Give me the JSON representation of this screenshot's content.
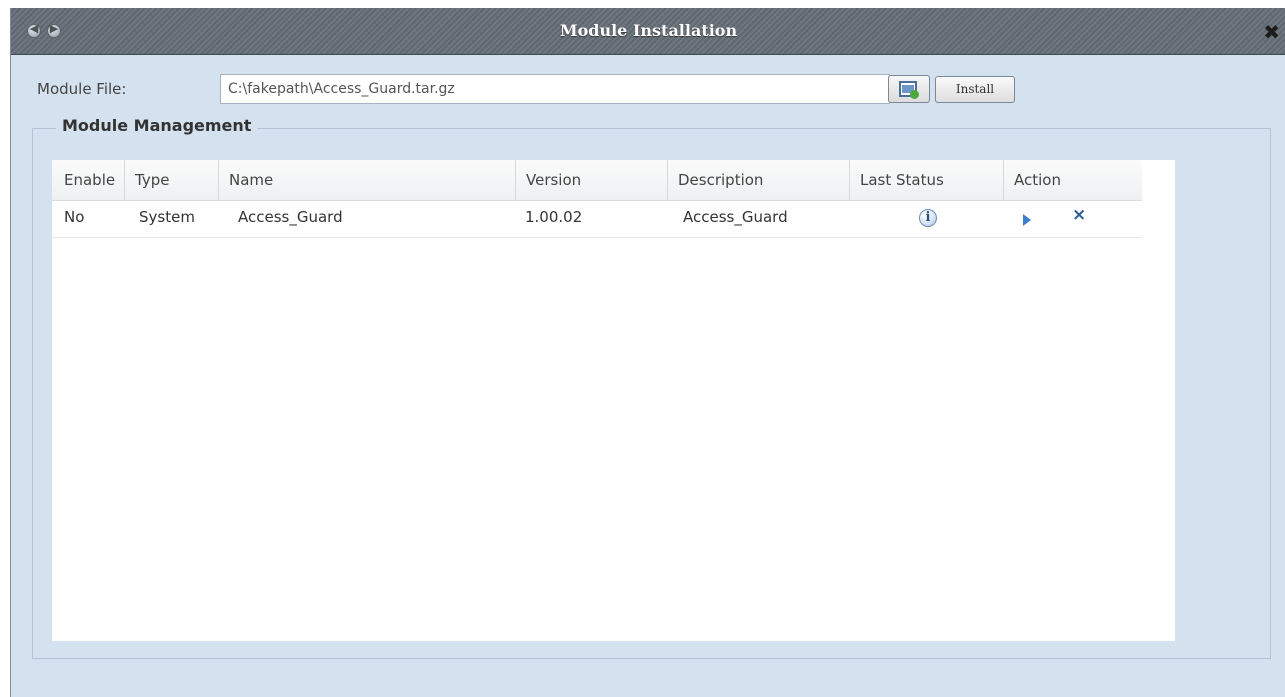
{
  "window": {
    "title": "Module Installation",
    "close_glyph": "✖",
    "back_glyph": "◀",
    "forward_glyph": "▶"
  },
  "file_row": {
    "label": "Module File:",
    "value": "C:\\fakepath\\Access_Guard.tar.gz",
    "browse_icon": "browse-file-icon",
    "install_label": "Install"
  },
  "management": {
    "legend": "Module Management",
    "columns": [
      "Enable",
      "Type",
      "Name",
      "Version",
      "Description",
      "Last Status",
      "Action"
    ],
    "rows": [
      {
        "enable": "No",
        "type": "System",
        "name": "Access_Guard",
        "version": "1.00.02",
        "description": "Access_Guard",
        "status_icon": "info-icon",
        "status_glyph": "i",
        "actions": [
          "play-icon",
          "delete-icon"
        ],
        "delete_glyph": "×"
      }
    ]
  },
  "colors": {
    "window_bg": "#d4e1ef",
    "titlebar": "#6e7780",
    "accent_icon": "#3a7fd0"
  }
}
